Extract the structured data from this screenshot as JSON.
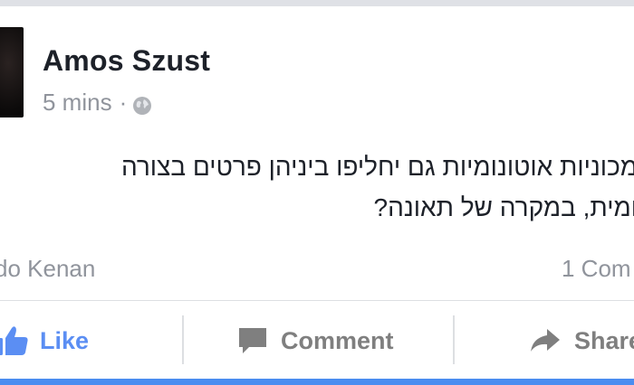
{
  "post": {
    "author": "Amos Szust",
    "timestamp": "5 mins",
    "separator": "·",
    "privacy_icon": "globe-icon",
    "text": "מכוניות אוטונומיות גם יחליפו ביניהן פרטים בצורה\nומית, במקרה של תאונה?",
    "reactor_name": "do Kenan",
    "comments_count": "1 Com"
  },
  "actions": {
    "like_label": "Like",
    "comment_label": "Comment",
    "share_label": "Share"
  },
  "colors": {
    "like_blue": "#5b8ef3",
    "bottom_bar": "#4a8df0",
    "text_dark": "#1d2129",
    "text_gray": "#90949c"
  }
}
